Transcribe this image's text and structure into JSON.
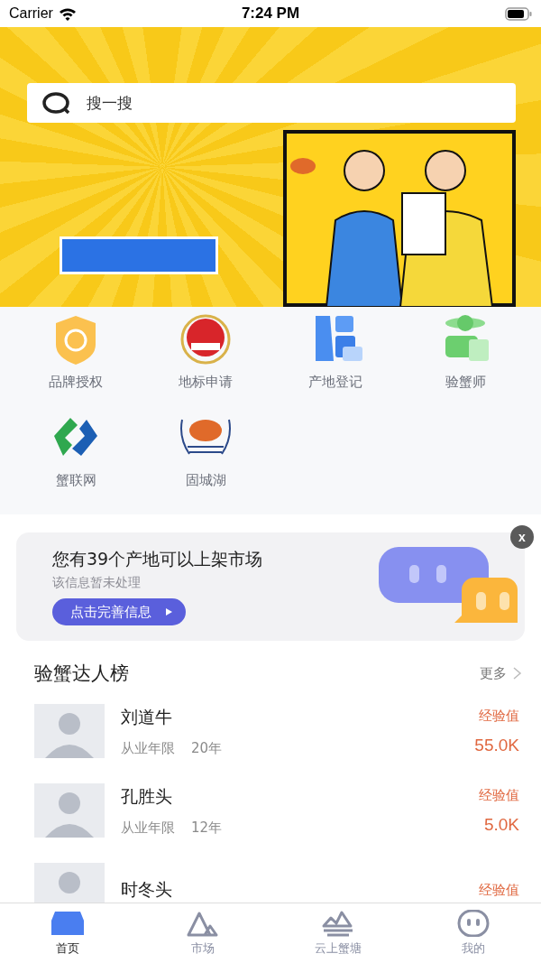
{
  "status_bar": {
    "carrier": "Carrier",
    "time": "7:24 PM"
  },
  "search": {
    "placeholder": "搜一搜"
  },
  "shortcuts": [
    {
      "label": "品牌授权",
      "kind": "shield"
    },
    {
      "label": "地标申请",
      "kind": "seal"
    },
    {
      "label": "产地登记",
      "kind": "blocks"
    },
    {
      "label": "验蟹师",
      "kind": "inspector"
    },
    {
      "label": "蟹联网",
      "kind": "logo"
    },
    {
      "label": "固城湖",
      "kind": "emblem"
    }
  ],
  "notice": {
    "title": "您有39个产地可以上架市场",
    "subtitle": "该信息暂未处理",
    "button": "点击完善信息",
    "close": "x"
  },
  "leaderboard": {
    "title": "验蟹达人榜",
    "more": "更多",
    "rows": [
      {
        "name": "刘道牛",
        "years_label": "从业年限",
        "years": "20年",
        "score_label": "经验值",
        "score": "55.0K"
      },
      {
        "name": "孔胜头",
        "years_label": "从业年限",
        "years": "12年",
        "score_label": "经验值",
        "score": "5.0K"
      },
      {
        "name": "时冬头",
        "score_label": "经验值"
      }
    ]
  },
  "tab_bar": [
    {
      "label": "首页",
      "kind": "home",
      "selected": true
    },
    {
      "label": "市场",
      "kind": "market",
      "selected": false
    },
    {
      "label": "云上蟹塘",
      "kind": "pond",
      "selected": false
    },
    {
      "label": "我的",
      "kind": "me",
      "selected": false
    }
  ]
}
